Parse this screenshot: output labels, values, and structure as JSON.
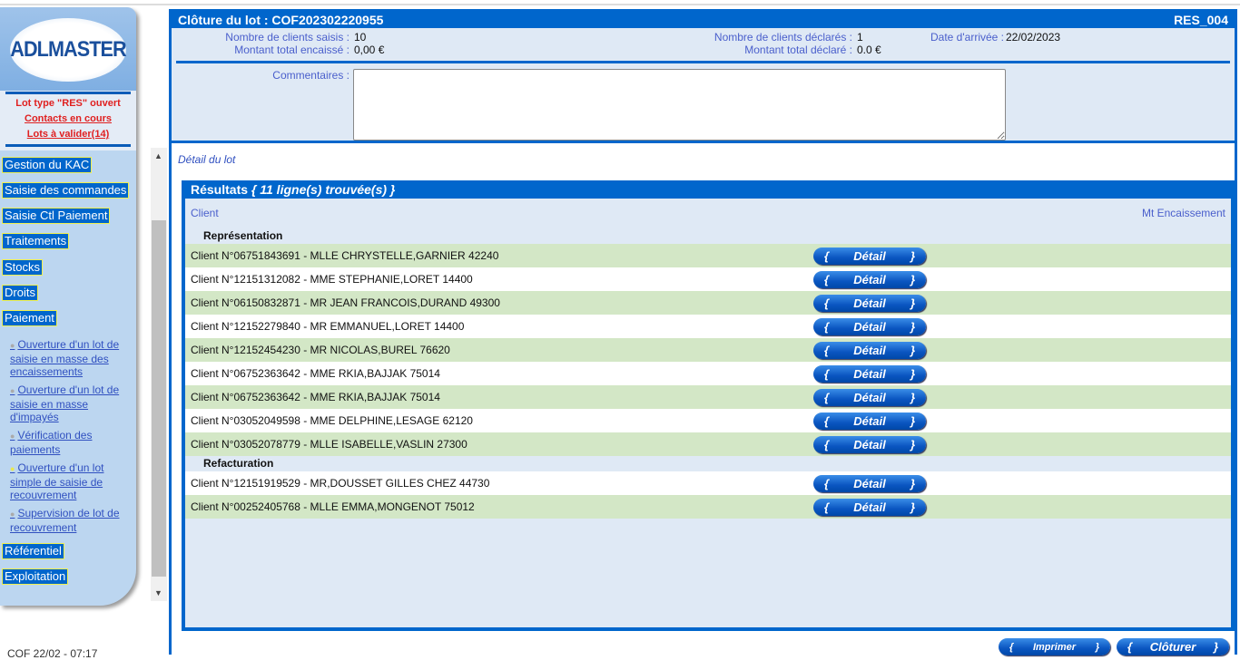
{
  "sidebar": {
    "logo": "ADLMASTER",
    "status": "Lot type \"RES\" ouvert",
    "contacts": "Contacts en cours",
    "lots": "Lots à valider(14)",
    "menu": [
      "Gestion du KAC",
      "Saisie des commandes",
      "Saisie Ctl Paiement",
      "Traitements",
      "Stocks",
      "Droits",
      "Paiement"
    ],
    "submenu": [
      "Ouverture d'un lot de saisie en masse des encaissements",
      "Ouverture d'un lot de saisie en masse d'impayés",
      "Vérification des paiements",
      "Ouverture d'un lot simple de saisie de recouvrement",
      "Supervision de lot de recouvrement"
    ],
    "menu2": [
      "Référentiel",
      "Exploitation"
    ],
    "footer": "COF 22/02 - 07:17"
  },
  "header": {
    "title": "Clôture du lot : COF202302220955",
    "code": "RES_004"
  },
  "info": {
    "clients_saisis_label": "Nombre de clients saisis :",
    "clients_saisis": "10",
    "montant_encaisse_label": "Montant total encaissé :",
    "montant_encaisse": "0,00 €",
    "clients_declares_label": "Nombre de clients déclarés :",
    "clients_declares": "1",
    "montant_declare_label": "Montant total déclaré :",
    "montant_declare": "0.0 €",
    "date_label": "Date d'arrivée :",
    "date": "22/02/2023",
    "commentaires_label": "Commentaires :",
    "commentaires": ""
  },
  "detail_title": "Détail du lot",
  "results": {
    "title": "Résultats",
    "count": "{ 11 ligne(s) trouvée(s) }",
    "col_client": "Client",
    "col_amount": "Mt Encaissement",
    "detail_label": "Détail",
    "groups": [
      {
        "name": "Représentation",
        "rows": [
          "Client N°06751843691 - MLLE CHRYSTELLE,GARNIER 42240",
          "Client N°12151312082 - MME STEPHANIE,LORET 14400",
          "Client N°06150832871 - MR JEAN FRANCOIS,DURAND 49300",
          "Client N°12152279840 - MR EMMANUEL,LORET 14400",
          "Client N°12152454230 - MR NICOLAS,BUREL 76620",
          "Client N°06752363642 - MME RKIA,BAJJAK 75014",
          "Client N°06752363642 - MME RKIA,BAJJAK 75014",
          "Client N°03052049598 - MME DELPHINE,LESAGE 62120",
          "Client N°03052078779 - MLLE ISABELLE,VASLIN 27300"
        ]
      },
      {
        "name": "Refacturation",
        "rows": [
          "Client N°12151919529 - MR,DOUSSET GILLES CHEZ 44730",
          "Client N°00252405768 - MLLE EMMA,MONGENOT 75012"
        ]
      }
    ]
  },
  "actions": {
    "print": "Imprimer",
    "close": "Clôturer"
  }
}
